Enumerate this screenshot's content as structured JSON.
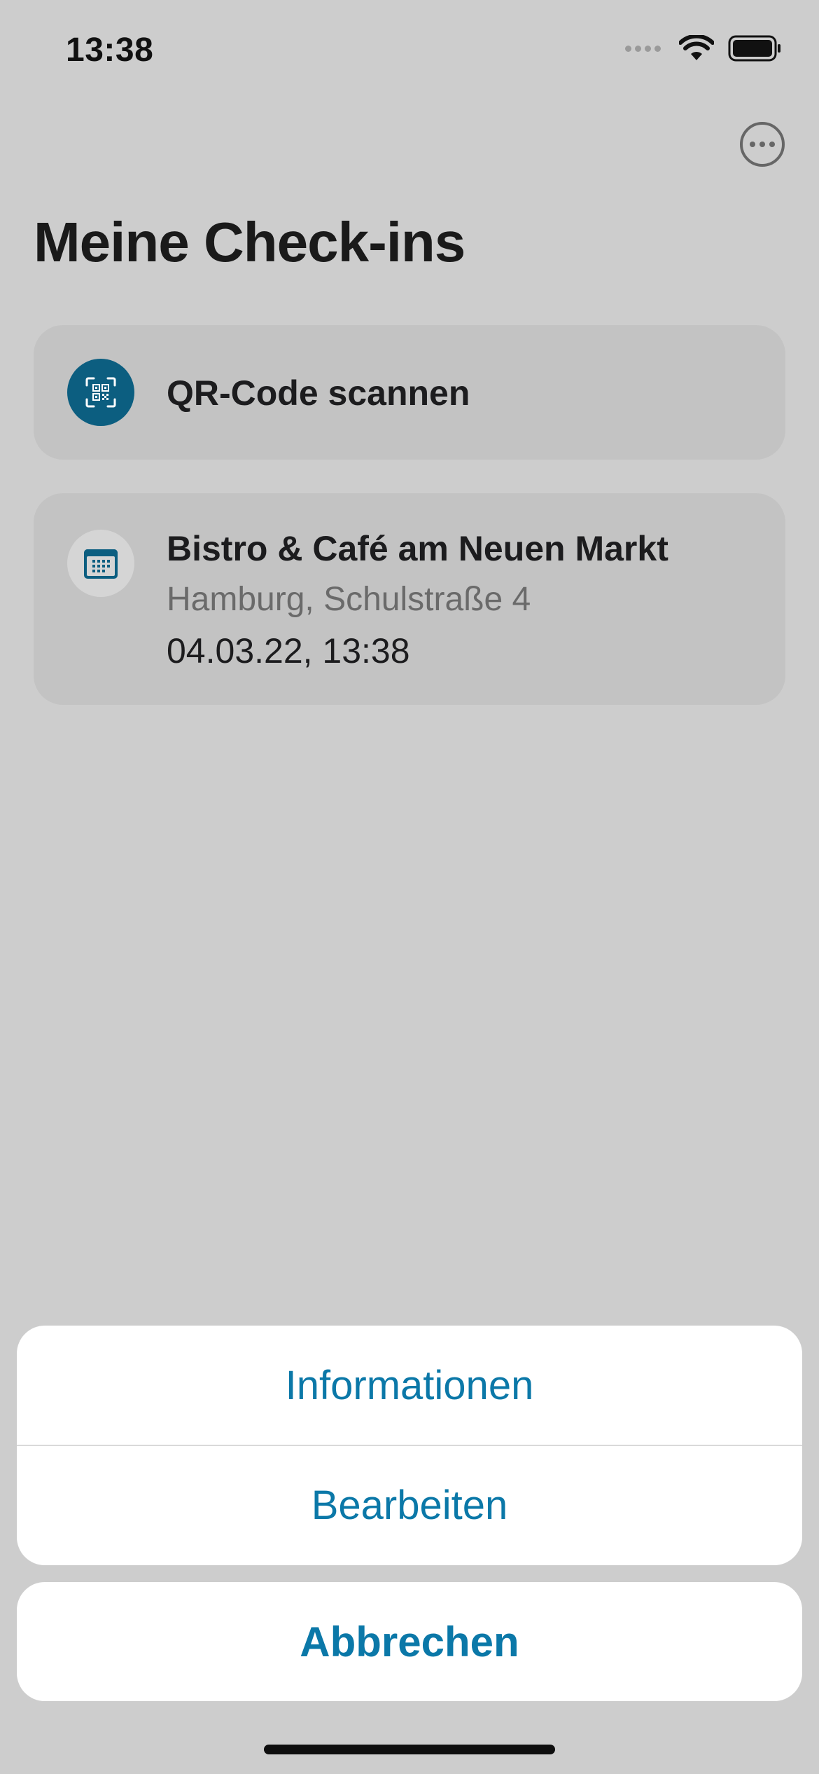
{
  "status_bar": {
    "time": "13:38"
  },
  "header": {
    "title": "Meine Check-ins"
  },
  "scan_card": {
    "label": "QR-Code scannen",
    "icon": "qr-code-icon"
  },
  "checkin": {
    "name": "Bistro & Café am Neuen Markt",
    "address": "Hamburg, Schulstraße 4",
    "datetime": "04.03.22, 13:38",
    "icon": "calendar-icon"
  },
  "action_sheet": {
    "items": [
      {
        "label": "Informationen"
      },
      {
        "label": "Bearbeiten"
      }
    ],
    "cancel_label": "Abbrechen"
  },
  "colors": {
    "accent": "#0b78a8",
    "icon_bg": "#0c5e80",
    "background": "#cdcdcd",
    "card": "#c3c3c3"
  }
}
